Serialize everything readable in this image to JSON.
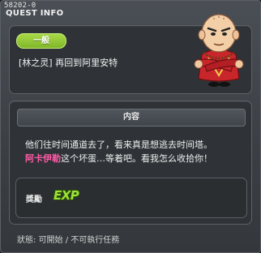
{
  "quest_id": "58202-0",
  "window_title": "QUEST INFO",
  "category_pill": "一般",
  "quest_title": "[林之灵] 再回到阿里安特",
  "content_header": "内容",
  "dialogue": {
    "line1": "他们往时间通道去了，看来真是想逃去时间塔。",
    "line2_highlight": "阿卡伊勒",
    "line2_rest": "这个坏蛋…等着吧。看我怎么收拾你！"
  },
  "reward": {
    "label": "獎勵",
    "exp_text": "EXP"
  },
  "status": "狀態: 可開始 / 不可執行任務",
  "colors": {
    "pill": "#8cc634",
    "highlight": "#ff5aa6",
    "exp": "#9be23a"
  },
  "icons": {
    "npc": "bald-monk-npc-portrait"
  }
}
